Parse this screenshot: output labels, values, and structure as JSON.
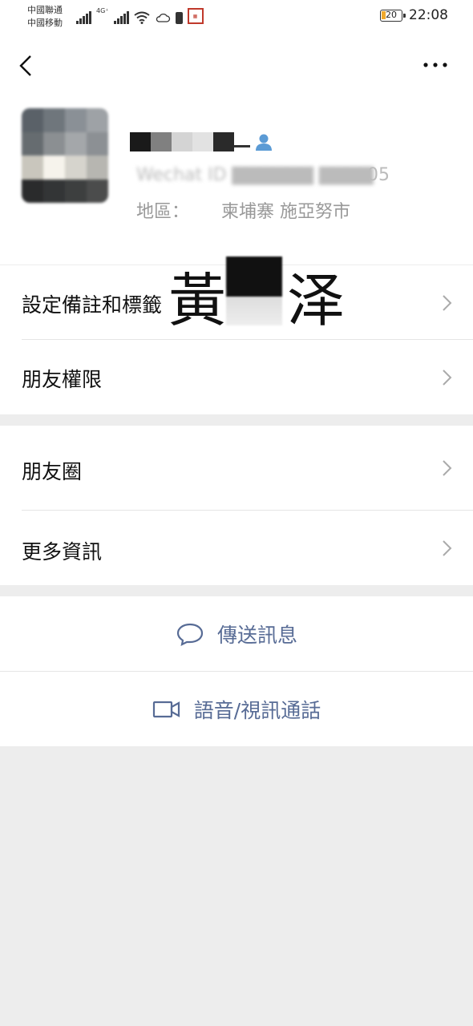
{
  "status_bar": {
    "carrier_1": "中國聯通",
    "carrier_2": "中國移動",
    "network_label": "4G⁺",
    "battery": "20",
    "time": "22:08"
  },
  "header": {
    "back_icon": "chevron-left-icon",
    "more_icon": "more-dots-icon"
  },
  "profile": {
    "id_visible_suffix": "05",
    "region_label": "地區：",
    "region_value": "柬埔寨  施亞努市",
    "overlay_text": "黃　泽"
  },
  "menu": {
    "items": [
      {
        "label": "設定備註和標籤",
        "icon": "chevron-right-icon"
      },
      {
        "label": "朋友權限",
        "icon": "chevron-right-icon"
      }
    ],
    "items2": [
      {
        "label": "朋友圈",
        "icon": "chevron-right-icon"
      },
      {
        "label": "更多資訊",
        "icon": "chevron-right-icon"
      }
    ]
  },
  "actions": {
    "send_message": "傳送訊息",
    "call": "語音/視訊通話"
  },
  "colors": {
    "accent": "#576b95",
    "background": "#ededed",
    "battery_fill": "#f0a92c"
  }
}
